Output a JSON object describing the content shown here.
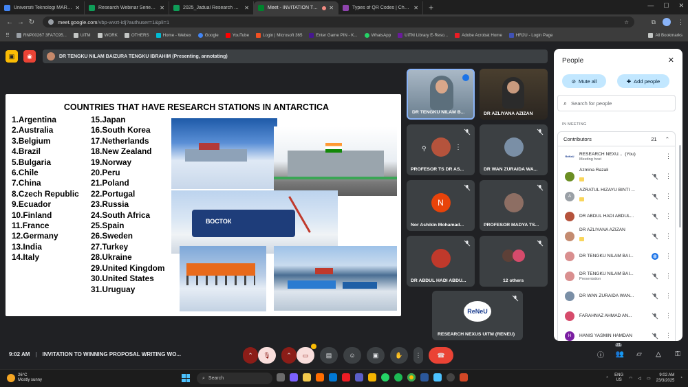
{
  "browser": {
    "tabs": [
      {
        "label": "Universiti Teknologi MARA - Ca",
        "color": "#4285f4"
      },
      {
        "label": "Research Webinar Series 7.0 20",
        "color": "#0f9d58"
      },
      {
        "label": "2025_Jadual Research Webinar",
        "color": "#0f9d58"
      },
      {
        "label": "Meet - INVITATION TO WI",
        "color": "#00832d"
      },
      {
        "label": "Types of QR Codes | Choose di",
        "color": "#8e44ad"
      }
    ],
    "url_host": "meet.google.com",
    "url_path": "/vbp-wvzt-idj?authuser=1&pli=1",
    "bookmarks": [
      {
        "label": "RNP00267 3FA7C95...",
        "color": "#9aa0a6"
      },
      {
        "label": "UiTM",
        "color": "#f2c94c"
      },
      {
        "label": "WORK",
        "color": "#f2c94c"
      },
      {
        "label": "OTHERS",
        "color": "#f2c94c"
      },
      {
        "label": "Home - Webex",
        "color": "#00bcd4"
      },
      {
        "label": "Google",
        "color": "#4285f4"
      },
      {
        "label": "YouTube",
        "color": "#ff0000"
      },
      {
        "label": "Login | Microsoft 365",
        "color": "#f25022"
      },
      {
        "label": "Enter Game PIN - K...",
        "color": "#46178f"
      },
      {
        "label": "WhatsApp",
        "color": "#25d366"
      },
      {
        "label": "UiTM Library E-Reso...",
        "color": "#6a1b9a"
      },
      {
        "label": "Adobe Acrobat Home",
        "color": "#ec1c24"
      },
      {
        "label": "HR2U - Login Page",
        "color": "#3f51b5"
      }
    ],
    "all_bookmarks": "All Bookmarks"
  },
  "meet": {
    "presenter_label": "DR TENGKU NILAM BAIZURA TENGKU IBRAHIM (Presenting, annotating)",
    "clock": "9:02 AM",
    "meeting_title": "INVITATION TO WINNING PROPOSAL WRITING WO...",
    "participant_badge": "21"
  },
  "slide": {
    "title": "COUNTRIES THAT HAVE RESEARCH STATIONS IN ANTARCTICA",
    "col1": [
      "1.Argentina",
      "2.Australia",
      "3.Belgium",
      "4.Brazil",
      "5.Bulgaria",
      "6.Chile",
      "7.China",
      "8.Czech Republic",
      "9.Ecuador",
      "10.Finland",
      "11.France",
      "12.Germany",
      "13.India",
      "14.Italy"
    ],
    "col2": [
      "15.Japan",
      "16.South Korea",
      "17.Netherlands",
      "18.New Zealand",
      "19.Norway",
      "20.Peru",
      "21.Poland",
      "22.Portugal",
      "23.Russia",
      "24.South Africa",
      "25.Spain",
      "26.Sweden",
      "27.Turkey",
      "28.Ukraine",
      "29.United Kingdom",
      "30.United States",
      "31.Uruguay"
    ],
    "vostok_sign": "ВОСТОК"
  },
  "tiles": [
    {
      "name": "DR TENGKU NILAM B...",
      "kind": "video"
    },
    {
      "name": "DR AZLIYANA AZIZAN",
      "kind": "video"
    },
    {
      "name": "PROFESOR TS DR AS...",
      "kind": "avatar"
    },
    {
      "name": "DR WAN ZURAIDA WA...",
      "kind": "avatar"
    },
    {
      "name": "Nor Ashikin Mohamad...",
      "kind": "letter",
      "letter": "N"
    },
    {
      "name": "PROFESOR MADYA TS...",
      "kind": "avatar"
    },
    {
      "name": "DR ABDUL HADI ABDU...",
      "kind": "avatar"
    },
    {
      "name": "12 others",
      "kind": "others"
    },
    {
      "name": "RESEARCH NEXUS UITM (RENEU)",
      "kind": "logo",
      "logo": "ReNeU"
    }
  ],
  "people": {
    "title": "People",
    "mute_all": "Mute all",
    "add_people": "Add people",
    "search_placeholder": "Search for people",
    "section": "IN MEETING",
    "contributors_label": "Contributors",
    "contributors_count": "21",
    "rows": [
      {
        "name": "RESEARCH NEXU...",
        "you": "(You)",
        "sub": "Meeting host",
        "color": "#ffffff",
        "initial": "ReNeU"
      },
      {
        "name": "Azmina Razali",
        "sub": "",
        "color": "#6b8e23",
        "initial": ""
      },
      {
        "name": "AZRATUL HIZAYU BINTI ...",
        "sub": "",
        "color": "#9aa0a6",
        "initial": "A"
      },
      {
        "name": "DR ABDUL HADI ABDUL...",
        "sub": "",
        "color": "#b5533c",
        "initial": ""
      },
      {
        "name": "DR AZLIYANA AZIZAN",
        "sub": "",
        "color": "#c48b70",
        "initial": ""
      },
      {
        "name": "DR TENGKU NILAM BAI...",
        "sub": "",
        "color": "#d98f8f",
        "initial": ""
      },
      {
        "name": "DR TENGKU NILAM BAI...",
        "sub": "Presentation",
        "color": "#d98f8f",
        "initial": ""
      },
      {
        "name": "DR WAN ZURAIDA WAN...",
        "sub": "",
        "color": "#7a8fa6",
        "initial": ""
      },
      {
        "name": "FARAHNAZ AHMAD AN...",
        "sub": "",
        "color": "#d64b6b",
        "initial": ""
      },
      {
        "name": "HANIS YASMIN HAMDAN",
        "sub": "",
        "color": "#7b1fa2",
        "initial": "H"
      }
    ]
  },
  "taskbar": {
    "temp": "26°C",
    "weather": "Mostly sunny",
    "search": "Search",
    "lang1": "ENG",
    "lang2": "US",
    "time": "9:02 AM",
    "date": "23/3/2025"
  }
}
